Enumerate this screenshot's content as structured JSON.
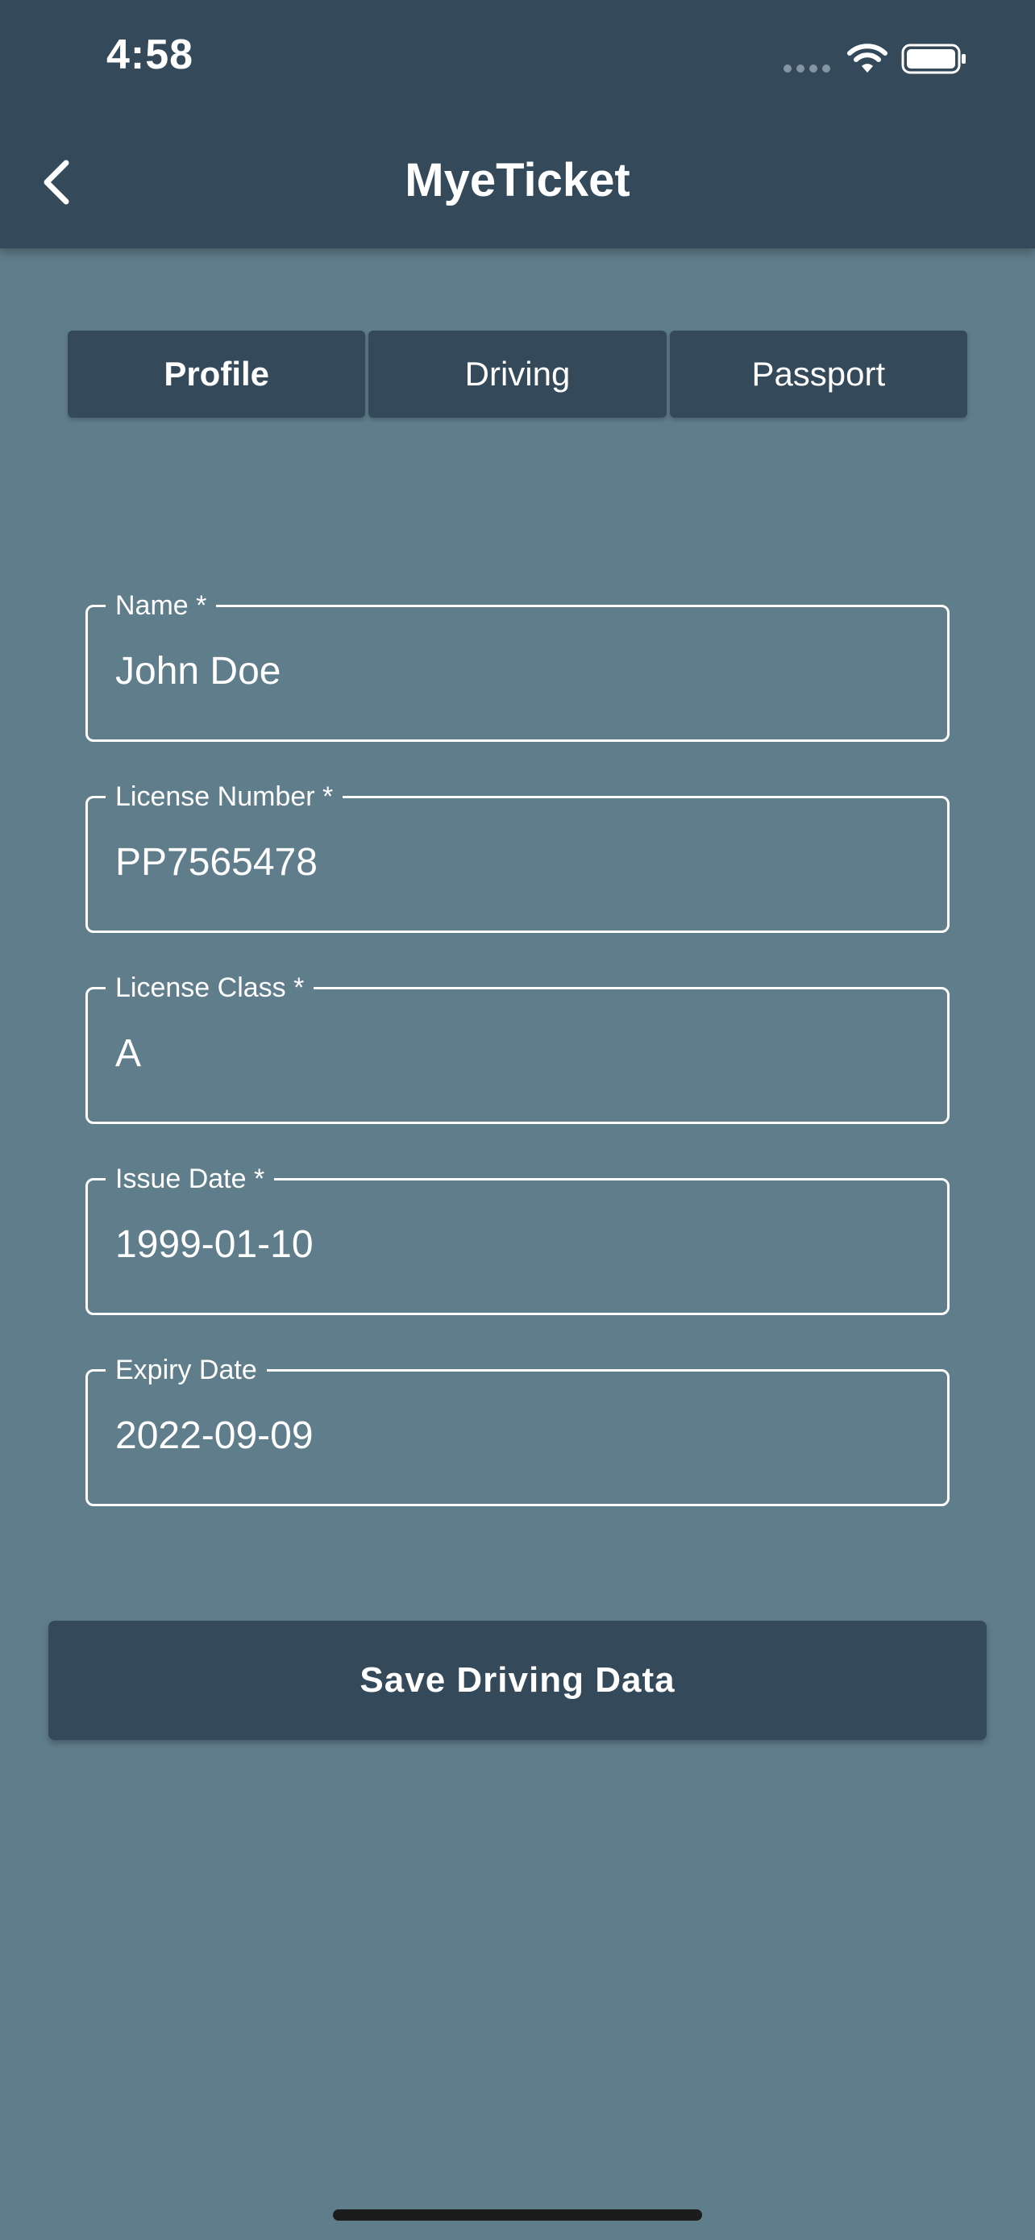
{
  "status_bar": {
    "time": "4:58"
  },
  "header": {
    "title": "MyeTicket"
  },
  "tabs": [
    {
      "label": "Profile",
      "active": true
    },
    {
      "label": "Driving",
      "active": false
    },
    {
      "label": "Passport",
      "active": false
    }
  ],
  "form": {
    "fields": [
      {
        "label": "Name *",
        "value": "John Doe"
      },
      {
        "label": "License Number *",
        "value": "PP7565478"
      },
      {
        "label": "License Class *",
        "value": "A"
      },
      {
        "label": "Issue Date *",
        "value": "1999-01-10"
      },
      {
        "label": "Expiry Date",
        "value": "2022-09-09"
      }
    ]
  },
  "actions": {
    "save_label": "Save Driving Data"
  },
  "colors": {
    "header": "#34495a",
    "background": "#607d8b",
    "text": "#ffffff"
  }
}
